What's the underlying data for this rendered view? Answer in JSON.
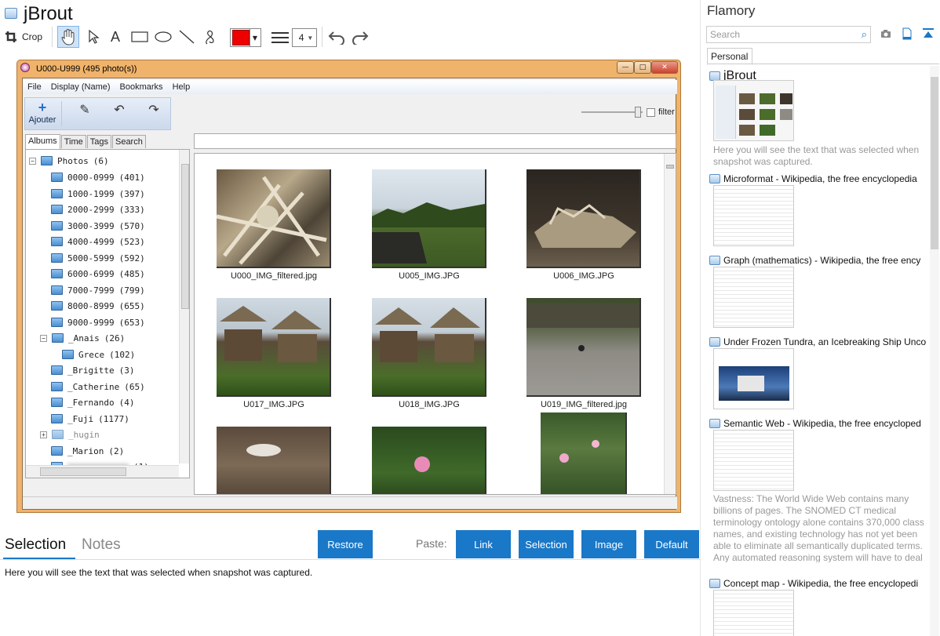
{
  "app": {
    "title": "jBrout"
  },
  "toolbar": {
    "crop_label": "Crop",
    "line_width": "4",
    "color": "#ee0000"
  },
  "window": {
    "title": "U000-U999 (495 photo(s))",
    "menu": [
      "File",
      "Display (Name)",
      "Bookmarks",
      "Help"
    ],
    "add_label": "Ajouter",
    "filter_label": "filter",
    "tabs": [
      "Albums",
      "Time",
      "Tags",
      "Search"
    ],
    "tree": [
      {
        "name": "Photos",
        "count": "(6)"
      },
      {
        "name": "0000-0999",
        "count": "(401)"
      },
      {
        "name": "1000-1999",
        "count": "(397)"
      },
      {
        "name": "2000-2999",
        "count": "(333)"
      },
      {
        "name": "3000-3999",
        "count": "(570)"
      },
      {
        "name": "4000-4999",
        "count": "(523)"
      },
      {
        "name": "5000-5999",
        "count": "(592)"
      },
      {
        "name": "6000-6999",
        "count": "(485)"
      },
      {
        "name": "7000-7999",
        "count": "(799)"
      },
      {
        "name": "8000-8999",
        "count": "(655)"
      },
      {
        "name": "9000-9999",
        "count": "(653)"
      },
      {
        "name": "_Anais",
        "count": "(26)"
      },
      {
        "name": "Grece",
        "count": "(102)"
      },
      {
        "name": "_Brigitte",
        "count": "(3)"
      },
      {
        "name": "_Catherine",
        "count": "(65)"
      },
      {
        "name": "_Fernando",
        "count": "(4)"
      },
      {
        "name": "_Fuji",
        "count": "(1177)"
      },
      {
        "name": "_hugin",
        "count": ""
      },
      {
        "name": "_Marion",
        "count": "(2)"
      },
      {
        "name": "",
        "count": "(1)"
      }
    ],
    "photos": [
      "U000_IMG_filtered.jpg",
      "U005_IMG.JPG",
      "U006_IMG.JPG",
      "U017_IMG.JPG",
      "U018_IMG.JPG",
      "U019_IMG_filtered.jpg"
    ]
  },
  "bottom": {
    "tab_selection": "Selection",
    "tab_notes": "Notes",
    "restore": "Restore",
    "paste_label": "Paste:",
    "link": "Link",
    "selection": "Selection",
    "image": "Image",
    "default": "Default",
    "selected_text": "Here you will see the text that was selected when snapshot was captured."
  },
  "right": {
    "title": "Flamory",
    "search_placeholder": "Search",
    "tab": "Personal",
    "items": [
      {
        "title": "jBrout",
        "desc": "Here you will see the text that was selected when snapshot was captured."
      },
      {
        "title": "Microformat - Wikipedia, the free encyclopedia",
        "desc": ""
      },
      {
        "title": "Graph (mathematics) - Wikipedia, the free ency",
        "desc": ""
      },
      {
        "title": "Under Frozen Tundra, an Icebreaking Ship Unco",
        "desc": ""
      },
      {
        "title": "Semantic Web - Wikipedia, the free encycloped",
        "desc": "Vastness: The World Wide Web contains many billions of pages. The SNOMED CT medical terminology ontology alone contains 370,000 class names, and existing technology has not yet been able to eliminate all semantically duplicated terms. Any automated reasoning system will have to deal with truly huge inputs."
      },
      {
        "title": "Concept map - Wikipedia, the free encyclopedi",
        "desc": ""
      }
    ]
  }
}
